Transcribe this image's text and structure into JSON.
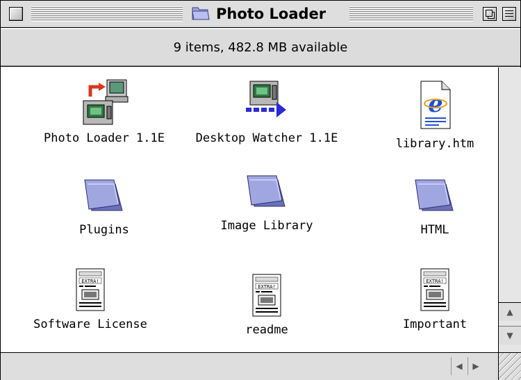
{
  "window": {
    "title": "Photo Loader"
  },
  "info_bar": {
    "status": "9 items, 482.8 MB available"
  },
  "items": [
    {
      "label": "Photo Loader 1.1E",
      "icon": "photo-loader-app-icon"
    },
    {
      "label": "Desktop Watcher 1.1E",
      "icon": "desktop-watcher-app-icon"
    },
    {
      "label": "library.htm",
      "icon": "internet-explorer-document-icon"
    },
    {
      "label": "Plugins",
      "icon": "folder-icon"
    },
    {
      "label": "Image Library",
      "icon": "folder-icon"
    },
    {
      "label": "HTML",
      "icon": "folder-icon"
    },
    {
      "label": "Software License",
      "icon": "simpletext-document-icon"
    },
    {
      "label": "readme",
      "icon": "simpletext-document-icon"
    },
    {
      "label": "Important",
      "icon": "simpletext-document-icon"
    }
  ],
  "colors": {
    "folder": "#9fa6e0",
    "folder_dark": "#6a71b8",
    "arrow_red": "#d8381f",
    "arrow_blue": "#2a2ad8",
    "screen_green": "#2e7a3e"
  }
}
